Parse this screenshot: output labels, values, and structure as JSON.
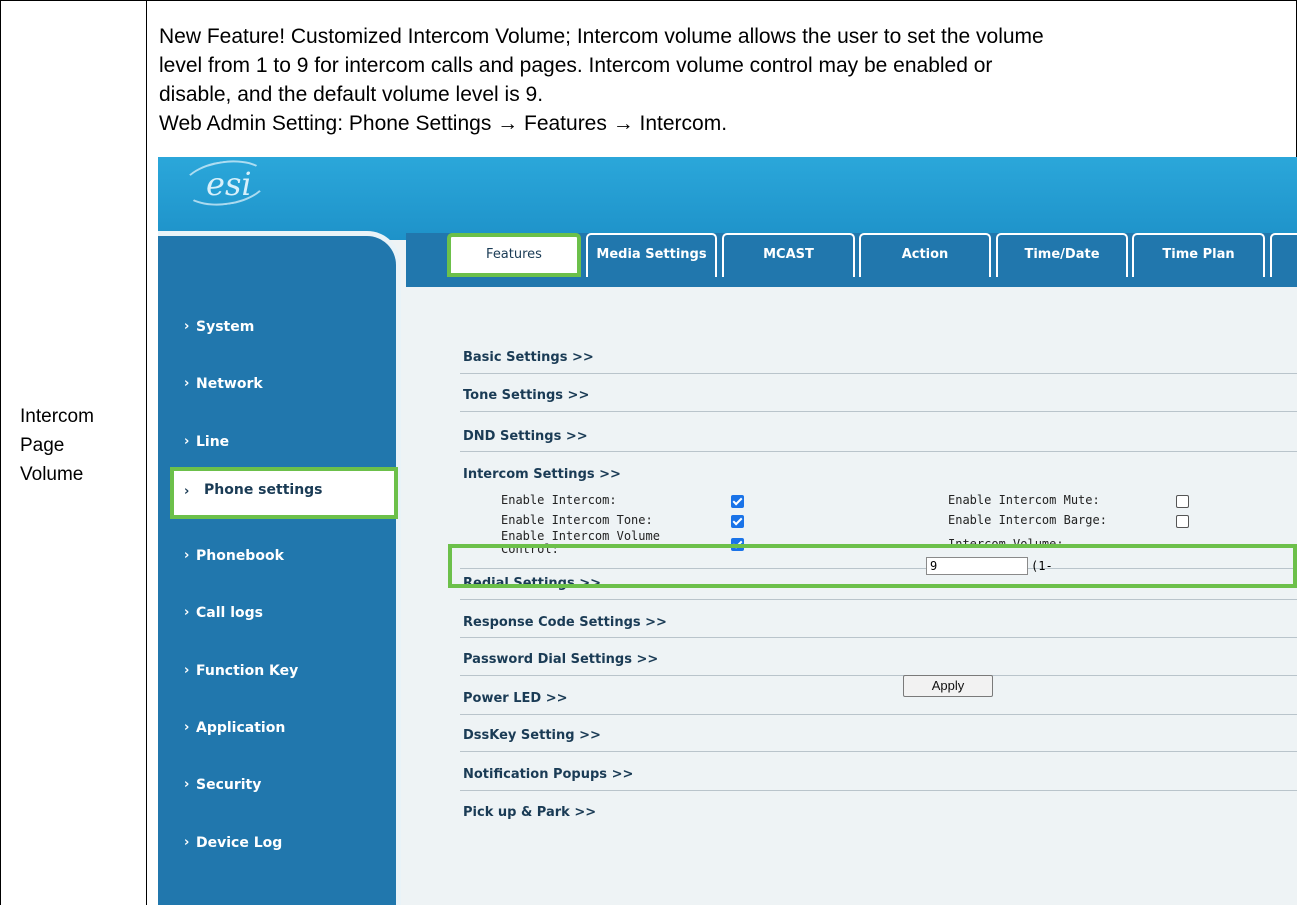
{
  "row_label": [
    "Intercom",
    "Page",
    "Volume"
  ],
  "description": [
    "New Feature! Customized Intercom Volume; Intercom volume allows the user to set the volume",
    "level from 1 to 9 for intercom calls and pages. Intercom volume control may be enabled or",
    "disable, and the default volume level is 9.",
    "Web Admin Setting: Phone Settings → Features → Intercom."
  ],
  "logo": "esi",
  "tabs": [
    "Features",
    "Media Settings",
    "MCAST",
    "Action",
    "Time/Date",
    "Time Plan"
  ],
  "active_tab": "Features",
  "sidebar": [
    "System",
    "Network",
    "Line",
    "Phone settings",
    "Phonebook",
    "Call logs",
    "Function Key",
    "Application",
    "Security",
    "Device Log"
  ],
  "active_sidebar": "Phone settings",
  "sections": {
    "basic": "Basic Settings >>",
    "tone": "Tone Settings >>",
    "dnd": "DND Settings >>",
    "intercom": "Intercom Settings >>",
    "redial": "Redial Settings >>",
    "response": "Response Code Settings >>",
    "password": "Password Dial Settings >>",
    "power": "Power LED >>",
    "dsskey": "DssKey Setting >>",
    "notify": "Notification Popups >>",
    "pickup": "Pick up & Park >>"
  },
  "intercom": {
    "enable_intercom": {
      "label": "Enable Intercom:",
      "checked": true
    },
    "enable_tone": {
      "label": "Enable Intercom Tone:",
      "checked": true
    },
    "enable_volume_control": {
      "label_line1": "Enable Intercom Volume",
      "label_line2": "Control:",
      "checked": true
    },
    "enable_mute": {
      "label": "Enable Intercom Mute:",
      "checked": false
    },
    "enable_barge": {
      "label": "Enable Intercom Barge:",
      "checked": false
    },
    "volume": {
      "label": "Intercom Volume:",
      "value": "9",
      "hint": "(1-"
    }
  },
  "apply_label": "Apply",
  "colors": {
    "highlight": "#6cc04a",
    "nav_blue": "#2177ad",
    "header_blue": "#2ba7da",
    "checkbox_blue": "#1a73e8"
  }
}
